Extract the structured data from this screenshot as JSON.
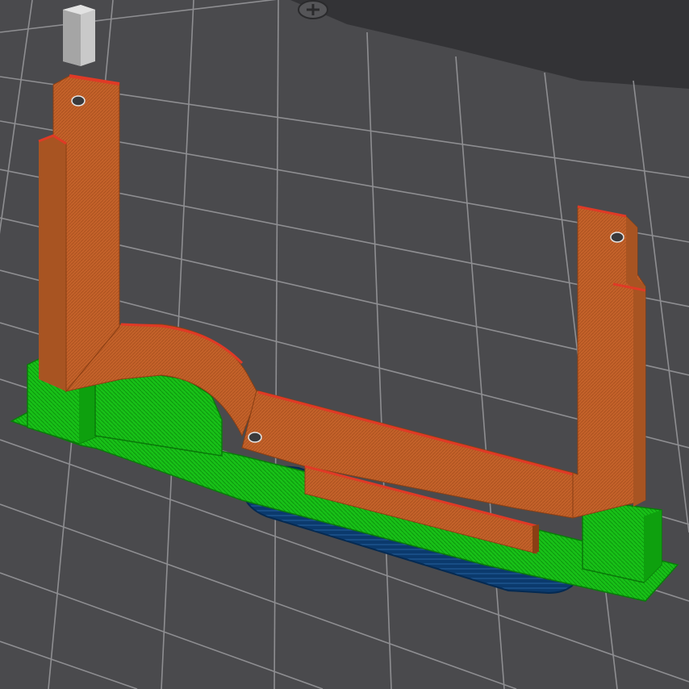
{
  "viewport": {
    "mode": "gcode-preview",
    "background_color": "#4a4a4d",
    "bed_grid_color": "#9a9a9e"
  },
  "colors": {
    "perimeter": "#c8642c",
    "perimeter_edge": "#d8402a",
    "support": "#1ec81e",
    "support_dark": "#0e9e0e",
    "brim": "#0a3b6e",
    "brim_line": "#3a7cc0",
    "wipe_tower": "#bfbfbf"
  },
  "icons": {
    "bed_screw": "screw-head-icon",
    "mount_holes": "hole-icon"
  }
}
